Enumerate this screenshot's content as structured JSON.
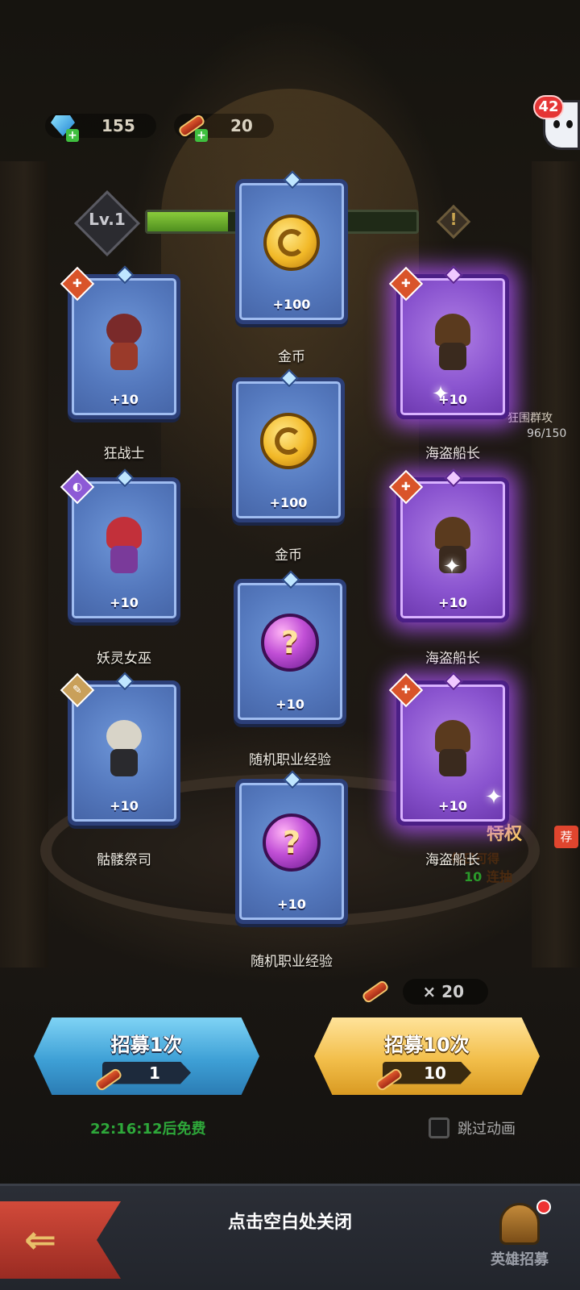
{
  "resources": [
    {
      "icon": "gem-icon",
      "value": "155"
    },
    {
      "icon": "scroll-icon",
      "value": "20"
    }
  ],
  "notifications": "42",
  "level": "Lv.1",
  "xp_fraction": 0.3,
  "cards": [
    {
      "id": "c1",
      "name": "狂战士",
      "amount": "+10",
      "rarity": "blue",
      "badge": "red",
      "art": "berserker"
    },
    {
      "id": "c2",
      "name": "妖灵女巫",
      "amount": "+10",
      "rarity": "blue",
      "badge": "violet",
      "art": "witch"
    },
    {
      "id": "c3",
      "name": "骷髅祭司",
      "amount": "+10",
      "rarity": "blue",
      "badge": "gold",
      "art": "skeleton"
    },
    {
      "id": "c4",
      "name": "金币",
      "amount": "+100",
      "rarity": "blue",
      "art": "coin"
    },
    {
      "id": "c5",
      "name": "金币",
      "amount": "+100",
      "rarity": "blue",
      "art": "coin"
    },
    {
      "id": "c6",
      "name": "随机职业经验",
      "amount": "+10",
      "rarity": "blue",
      "art": "orb"
    },
    {
      "id": "c7",
      "name": "随机职业经验",
      "amount": "+10",
      "rarity": "blue",
      "art": "orb"
    },
    {
      "id": "c8",
      "name": "海盗船长",
      "amount": "+10",
      "rarity": "purple",
      "badge": "red",
      "art": "pirate"
    },
    {
      "id": "c9",
      "name": "海盗船长",
      "amount": "+10",
      "rarity": "purple",
      "badge": "red",
      "art": "pirate"
    },
    {
      "id": "c10",
      "name": "海盗船长",
      "amount": "+10",
      "rarity": "purple",
      "badge": "red",
      "art": "pirate"
    }
  ],
  "side_widgets": {
    "siege_label": "狂围群攻",
    "siege_progress": "96/150",
    "privilege_label": "特权",
    "recommend": "荐",
    "daily_text": "每日可得",
    "draw_count": "10",
    "draw_text": "连抽"
  },
  "ticket_count": "× 20",
  "recruit_once": {
    "label": "招募1次",
    "cost": "1"
  },
  "recruit_ten": {
    "label": "招募10次",
    "cost": "10"
  },
  "free_timer": "22:16:12后免费",
  "skip_animation": "跳过动画",
  "close_hint": "点击空白处关闭",
  "hero_recruit_label": "英雄招募",
  "colors": {
    "rare_card": "#5478bd",
    "epic_card": "#8a54cf",
    "recruit_once": "#3ea0d6",
    "recruit_ten": "#f2be4a",
    "timer": "#2ea83a"
  }
}
